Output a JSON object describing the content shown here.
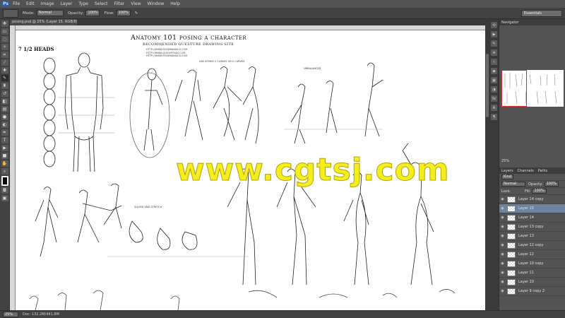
{
  "app": {
    "logo": "Ps"
  },
  "menu": [
    "File",
    "Edit",
    "Image",
    "Layer",
    "Type",
    "Select",
    "Filter",
    "View",
    "Window",
    "Help"
  ],
  "options": {
    "mode_label": "Mode:",
    "mode_value": "Normal",
    "opacity_label": "Opacity:",
    "opacity_value": "100%",
    "flow_label": "Flow:",
    "flow_value": "100%",
    "workspace": "Essentials"
  },
  "document": {
    "tab_title": "posing.psd @ 25% (Layer 15, RGB/8) *"
  },
  "artwork": {
    "title": "Anatomy 101 posing a character",
    "subtitle": "recommended guesture drawing site",
    "site1": "HTTP://WWW.POSEMANIACS.COM",
    "site2": "HTTP://WWW.QUICKPOSES.COM",
    "site3": "HTTP://WWW.POSEMANIACS.COM",
    "heads": "7 1/2 HEADS",
    "note_curves": "USE EITHER C CURVES OR S CURVES",
    "note_unbalanced": "UNBALANCED",
    "note_squash": "SQUISH AND STRETCH",
    "watermark": "www.cgtsj.com"
  },
  "status": {
    "zoom": "25%",
    "doc": "Doc: 132.2M/441.8M"
  },
  "panels": {
    "navigator_title": "Navigator",
    "navigator_zoom": "25%",
    "tabs": [
      "Layers",
      "Channels",
      "Paths"
    ],
    "kind_label": "Kind",
    "blend_mode": "Normal",
    "opacity_label": "Opacity:",
    "opacity_value": "100%",
    "lock_label": "Lock:",
    "fill_label": "Fill:",
    "fill_value": "100%"
  },
  "layers": [
    {
      "name": "Layer 14 copy",
      "selected": false
    },
    {
      "name": "Layer 15",
      "selected": true
    },
    {
      "name": "Layer 14",
      "selected": false
    },
    {
      "name": "Layer 13 copy",
      "selected": false
    },
    {
      "name": "Layer 13",
      "selected": false
    },
    {
      "name": "Layer 12 copy",
      "selected": false
    },
    {
      "name": "Layer 12",
      "selected": false
    },
    {
      "name": "Layer 10 copy",
      "selected": false
    },
    {
      "name": "Layer 11",
      "selected": false
    },
    {
      "name": "Layer 10",
      "selected": false
    },
    {
      "name": "Layer 9 copy 2",
      "selected": false
    }
  ]
}
